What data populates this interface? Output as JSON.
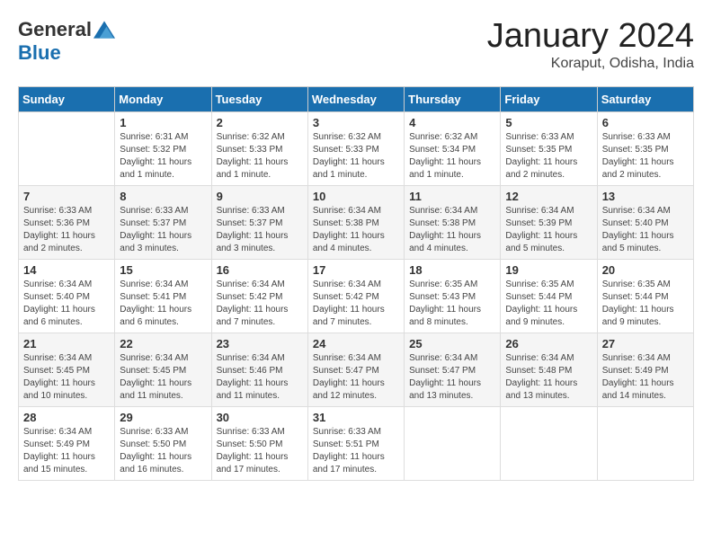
{
  "logo": {
    "general": "General",
    "blue": "Blue"
  },
  "title": "January 2024",
  "location": "Koraput, Odisha, India",
  "days_of_week": [
    "Sunday",
    "Monday",
    "Tuesday",
    "Wednesday",
    "Thursday",
    "Friday",
    "Saturday"
  ],
  "weeks": [
    [
      {
        "day": "",
        "sunrise": "",
        "sunset": "",
        "daylight": ""
      },
      {
        "day": "1",
        "sunrise": "Sunrise: 6:31 AM",
        "sunset": "Sunset: 5:32 PM",
        "daylight": "Daylight: 11 hours and 1 minute."
      },
      {
        "day": "2",
        "sunrise": "Sunrise: 6:32 AM",
        "sunset": "Sunset: 5:33 PM",
        "daylight": "Daylight: 11 hours and 1 minute."
      },
      {
        "day": "3",
        "sunrise": "Sunrise: 6:32 AM",
        "sunset": "Sunset: 5:33 PM",
        "daylight": "Daylight: 11 hours and 1 minute."
      },
      {
        "day": "4",
        "sunrise": "Sunrise: 6:32 AM",
        "sunset": "Sunset: 5:34 PM",
        "daylight": "Daylight: 11 hours and 1 minute."
      },
      {
        "day": "5",
        "sunrise": "Sunrise: 6:33 AM",
        "sunset": "Sunset: 5:35 PM",
        "daylight": "Daylight: 11 hours and 2 minutes."
      },
      {
        "day": "6",
        "sunrise": "Sunrise: 6:33 AM",
        "sunset": "Sunset: 5:35 PM",
        "daylight": "Daylight: 11 hours and 2 minutes."
      }
    ],
    [
      {
        "day": "7",
        "sunrise": "Sunrise: 6:33 AM",
        "sunset": "Sunset: 5:36 PM",
        "daylight": "Daylight: 11 hours and 2 minutes."
      },
      {
        "day": "8",
        "sunrise": "Sunrise: 6:33 AM",
        "sunset": "Sunset: 5:37 PM",
        "daylight": "Daylight: 11 hours and 3 minutes."
      },
      {
        "day": "9",
        "sunrise": "Sunrise: 6:33 AM",
        "sunset": "Sunset: 5:37 PM",
        "daylight": "Daylight: 11 hours and 3 minutes."
      },
      {
        "day": "10",
        "sunrise": "Sunrise: 6:34 AM",
        "sunset": "Sunset: 5:38 PM",
        "daylight": "Daylight: 11 hours and 4 minutes."
      },
      {
        "day": "11",
        "sunrise": "Sunrise: 6:34 AM",
        "sunset": "Sunset: 5:38 PM",
        "daylight": "Daylight: 11 hours and 4 minutes."
      },
      {
        "day": "12",
        "sunrise": "Sunrise: 6:34 AM",
        "sunset": "Sunset: 5:39 PM",
        "daylight": "Daylight: 11 hours and 5 minutes."
      },
      {
        "day": "13",
        "sunrise": "Sunrise: 6:34 AM",
        "sunset": "Sunset: 5:40 PM",
        "daylight": "Daylight: 11 hours and 5 minutes."
      }
    ],
    [
      {
        "day": "14",
        "sunrise": "Sunrise: 6:34 AM",
        "sunset": "Sunset: 5:40 PM",
        "daylight": "Daylight: 11 hours and 6 minutes."
      },
      {
        "day": "15",
        "sunrise": "Sunrise: 6:34 AM",
        "sunset": "Sunset: 5:41 PM",
        "daylight": "Daylight: 11 hours and 6 minutes."
      },
      {
        "day": "16",
        "sunrise": "Sunrise: 6:34 AM",
        "sunset": "Sunset: 5:42 PM",
        "daylight": "Daylight: 11 hours and 7 minutes."
      },
      {
        "day": "17",
        "sunrise": "Sunrise: 6:34 AM",
        "sunset": "Sunset: 5:42 PM",
        "daylight": "Daylight: 11 hours and 7 minutes."
      },
      {
        "day": "18",
        "sunrise": "Sunrise: 6:35 AM",
        "sunset": "Sunset: 5:43 PM",
        "daylight": "Daylight: 11 hours and 8 minutes."
      },
      {
        "day": "19",
        "sunrise": "Sunrise: 6:35 AM",
        "sunset": "Sunset: 5:44 PM",
        "daylight": "Daylight: 11 hours and 9 minutes."
      },
      {
        "day": "20",
        "sunrise": "Sunrise: 6:35 AM",
        "sunset": "Sunset: 5:44 PM",
        "daylight": "Daylight: 11 hours and 9 minutes."
      }
    ],
    [
      {
        "day": "21",
        "sunrise": "Sunrise: 6:34 AM",
        "sunset": "Sunset: 5:45 PM",
        "daylight": "Daylight: 11 hours and 10 minutes."
      },
      {
        "day": "22",
        "sunrise": "Sunrise: 6:34 AM",
        "sunset": "Sunset: 5:45 PM",
        "daylight": "Daylight: 11 hours and 11 minutes."
      },
      {
        "day": "23",
        "sunrise": "Sunrise: 6:34 AM",
        "sunset": "Sunset: 5:46 PM",
        "daylight": "Daylight: 11 hours and 11 minutes."
      },
      {
        "day": "24",
        "sunrise": "Sunrise: 6:34 AM",
        "sunset": "Sunset: 5:47 PM",
        "daylight": "Daylight: 11 hours and 12 minutes."
      },
      {
        "day": "25",
        "sunrise": "Sunrise: 6:34 AM",
        "sunset": "Sunset: 5:47 PM",
        "daylight": "Daylight: 11 hours and 13 minutes."
      },
      {
        "day": "26",
        "sunrise": "Sunrise: 6:34 AM",
        "sunset": "Sunset: 5:48 PM",
        "daylight": "Daylight: 11 hours and 13 minutes."
      },
      {
        "day": "27",
        "sunrise": "Sunrise: 6:34 AM",
        "sunset": "Sunset: 5:49 PM",
        "daylight": "Daylight: 11 hours and 14 minutes."
      }
    ],
    [
      {
        "day": "28",
        "sunrise": "Sunrise: 6:34 AM",
        "sunset": "Sunset: 5:49 PM",
        "daylight": "Daylight: 11 hours and 15 minutes."
      },
      {
        "day": "29",
        "sunrise": "Sunrise: 6:33 AM",
        "sunset": "Sunset: 5:50 PM",
        "daylight": "Daylight: 11 hours and 16 minutes."
      },
      {
        "day": "30",
        "sunrise": "Sunrise: 6:33 AM",
        "sunset": "Sunset: 5:50 PM",
        "daylight": "Daylight: 11 hours and 17 minutes."
      },
      {
        "day": "31",
        "sunrise": "Sunrise: 6:33 AM",
        "sunset": "Sunset: 5:51 PM",
        "daylight": "Daylight: 11 hours and 17 minutes."
      },
      {
        "day": "",
        "sunrise": "",
        "sunset": "",
        "daylight": ""
      },
      {
        "day": "",
        "sunrise": "",
        "sunset": "",
        "daylight": ""
      },
      {
        "day": "",
        "sunrise": "",
        "sunset": "",
        "daylight": ""
      }
    ]
  ]
}
